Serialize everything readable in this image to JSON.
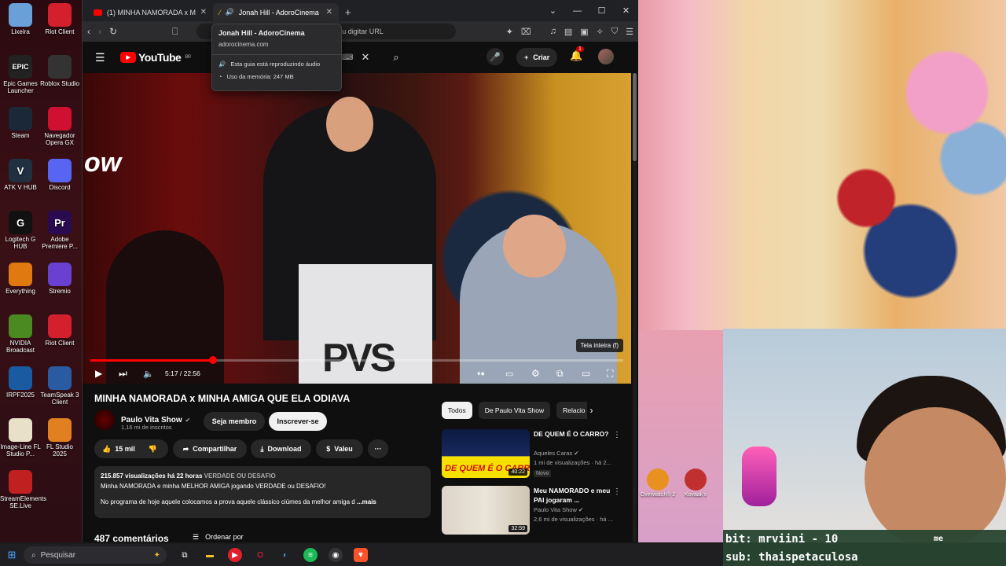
{
  "desktop": {
    "icons": [
      {
        "label": "Lixeira",
        "icon": "recycle-bin-icon",
        "color": "#6aa0d8"
      },
      {
        "label": "Riot Client",
        "icon": "riot-icon",
        "color": "#d4202c"
      },
      {
        "label": "Epic Games Launcher",
        "icon": "epic-icon",
        "color": "#222222",
        "glyph": "EPIC"
      },
      {
        "label": "Roblox Studio",
        "icon": "roblox-icon",
        "color": "#333333"
      },
      {
        "label": "Steam",
        "icon": "steam-icon",
        "color": "#1b2838"
      },
      {
        "label": "Navegador Opera GX",
        "icon": "opera-gx-icon",
        "color": "#d01030"
      },
      {
        "label": "ATK V HUB",
        "icon": "atk-icon",
        "color": "#203040",
        "glyph": "V"
      },
      {
        "label": "Discord",
        "icon": "discord-icon",
        "color": "#5865f2"
      },
      {
        "label": "Logitech G HUB",
        "icon": "logitech-icon",
        "color": "#111111",
        "glyph": "G"
      },
      {
        "label": "Adobe Premiere P...",
        "icon": "premiere-icon",
        "color": "#2a0a50",
        "glyph": "Pr"
      },
      {
        "label": "Everything",
        "icon": "everything-icon",
        "color": "#e07a10"
      },
      {
        "label": "Stremio",
        "icon": "stremio-icon",
        "color": "#6a40d0"
      },
      {
        "label": "NVIDIA Broadcast",
        "icon": "nvidia-icon",
        "color": "#4a8a20"
      },
      {
        "label": "Riot Client",
        "icon": "riot-icon-2",
        "color": "#d4202c"
      },
      {
        "label": "IRPF2025",
        "icon": "irpf-icon",
        "color": "#1a5aa0"
      },
      {
        "label": "TeamSpeak 3 Client",
        "icon": "teamspeak-icon",
        "color": "#2a5aa0"
      },
      {
        "label": "Image-Line FL Studio P...",
        "icon": "file-icon",
        "color": "#e8e0c8"
      },
      {
        "label": "FL Studio 2025",
        "icon": "fl-studio-icon",
        "color": "#e08020"
      },
      {
        "label": "StreamElements SE.Live",
        "icon": "streamelements-icon",
        "color": "#c02020"
      }
    ]
  },
  "browser": {
    "tabs": [
      {
        "title": "(1) MINHA NAMORADA x MINH",
        "active": false
      },
      {
        "title": "Jonah Hill - AdoroCinema",
        "active": true
      }
    ],
    "url_placeholder": "rave ou digitar URL",
    "tooltip": {
      "title": "Jonah Hill - AdoroCinema",
      "domain": "adorocinema.com",
      "audio": "Esta guia está reproduzindo áudio",
      "memory": "Uso da memória: 247 MB"
    }
  },
  "youtube": {
    "logo_text": "YouTube",
    "region": "BR",
    "create_label": "Criar",
    "notifications": "1",
    "video": {
      "overlay_text": "ow",
      "stage_logo": "PVS",
      "fullscreen_tip": "Tela inteira (f)",
      "time": "5:17 / 22:56",
      "progress": 0.23
    },
    "title": "MINHA NAMORADA x MINHA AMIGA QUE ELA ODIAVA",
    "channel": {
      "name": "Paulo Vita Show",
      "subs": "1,16 mi de inscritos",
      "member_label": "Seja membro",
      "subscribe_label": "Inscrever-se"
    },
    "actions": {
      "likes": "15 mil",
      "share": "Compartilhar",
      "download": "Download",
      "thanks": "Valeu"
    },
    "description": {
      "meta": "215.857 visualizações  há 22 horas",
      "tag": "VERDADE OU DESAFIO",
      "line1": "Minha NAMORADA e minha MELHOR AMIGA jogando VERDADE ou DESAFIO!",
      "line2": "No programa de hoje aquele colocamos a prova aquele clássico ciúmes da melhor amiga d",
      "more": "...mais"
    },
    "comments": "487 comentários",
    "sort_label": "Ordenar por",
    "chips": [
      "Todos",
      "De Paulo Vita Show",
      "Relacio"
    ],
    "suggestions": [
      {
        "title": "DE QUEM É O CARRO?",
        "channel": "Aqueles Caras",
        "views": "1 mi de visualizações · há 2...",
        "duration": "40:22",
        "badge": "Novo",
        "thumb_text": "DE QUEM É O CARRO?"
      },
      {
        "title": "Meu NAMORADO e meu PAI jogaram ...",
        "channel": "Paulo Vita Show",
        "views": "2,6 mi de visualizações · há ...",
        "duration": "32:59",
        "badge": ""
      }
    ]
  },
  "stream": {
    "bit_line": "bit: mrviini - 10",
    "sub_line": "sub: thaispetaculosa",
    "mini_text": "me",
    "desktop_icons": [
      {
        "label": "Overwatch® 2",
        "color": "#e89020"
      },
      {
        "label": "Kovaak's",
        "color": "#c03030"
      }
    ]
  },
  "taskbar": {
    "search_placeholder": "Pesquisar"
  }
}
